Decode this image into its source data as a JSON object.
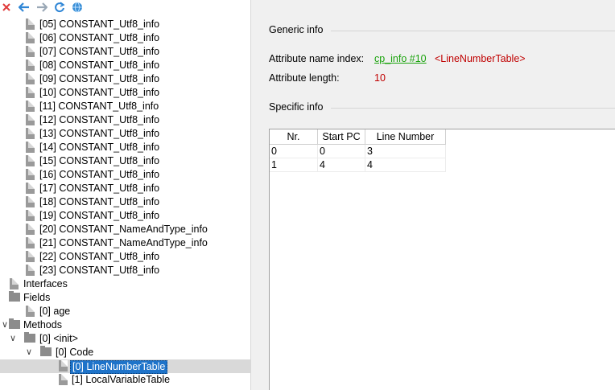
{
  "toolbar": {
    "buttons": [
      {
        "icon": "close-icon",
        "color": "#e03a3a"
      },
      {
        "icon": "back-arrow-icon",
        "color": "#2f86d6"
      },
      {
        "icon": "forward-arrow-icon",
        "color": "#9aa8b6"
      },
      {
        "icon": "refresh-icon",
        "color": "#2f86d6"
      },
      {
        "icon": "globe-icon",
        "color": "#3a8fd6"
      }
    ]
  },
  "tree": {
    "constants": [
      "[05] CONSTANT_Utf8_info",
      "[06] CONSTANT_Utf8_info",
      "[07] CONSTANT_Utf8_info",
      "[08] CONSTANT_Utf8_info",
      "[09] CONSTANT_Utf8_info",
      "[10] CONSTANT_Utf8_info",
      "[11] CONSTANT_Utf8_info",
      "[12] CONSTANT_Utf8_info",
      "[13] CONSTANT_Utf8_info",
      "[14] CONSTANT_Utf8_info",
      "[15] CONSTANT_Utf8_info",
      "[16] CONSTANT_Utf8_info",
      "[17] CONSTANT_Utf8_info",
      "[18] CONSTANT_Utf8_info",
      "[19] CONSTANT_Utf8_info",
      "[20] CONSTANT_NameAndType_info",
      "[21] CONSTANT_NameAndType_info",
      "[22] CONSTANT_Utf8_info",
      "[23] CONSTANT_Utf8_info"
    ],
    "interfaces": "Interfaces",
    "fields": "Fields",
    "field_age": "[0] age",
    "methods": "Methods",
    "method_init": "[0] <init>",
    "code": "[0] Code",
    "line_number_table": "[0] LineNumberTable",
    "local_variable_table": "[1] LocalVariableTable"
  },
  "panel": {
    "generic_info": "Generic info",
    "attr_name_index_label": "Attribute name index:",
    "attr_name_index_link": "cp_info #10",
    "attr_name_index_value": "<LineNumberTable>",
    "attr_length_label": "Attribute length:",
    "attr_length_value": "10",
    "specific_info": "Specific info",
    "table": {
      "headers": [
        "Nr.",
        "Start PC",
        "Line Number"
      ],
      "rows": [
        [
          "0",
          "0",
          "3"
        ],
        [
          "1",
          "4",
          "4"
        ]
      ]
    }
  }
}
